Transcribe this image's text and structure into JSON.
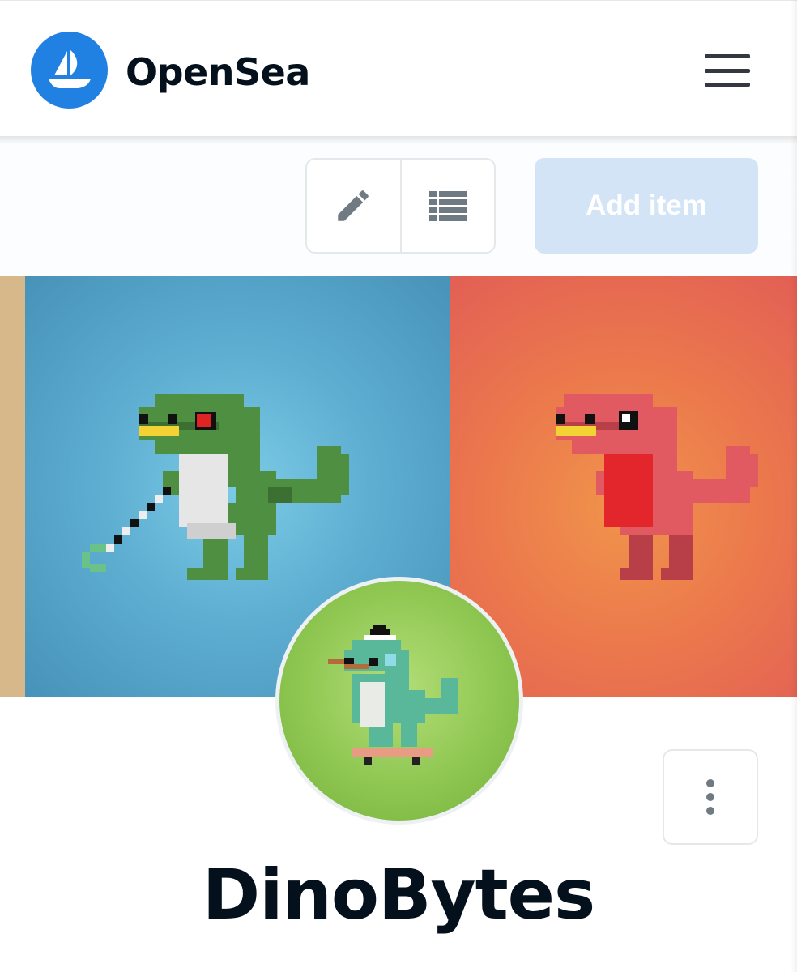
{
  "header": {
    "brand_name": "OpenSea",
    "logo_icon": "opensea-ship-icon",
    "menu_icon": "hamburger-menu-icon",
    "brand_color": "#2081e2"
  },
  "toolbar": {
    "edit_icon": "pencil-icon",
    "list_icon": "list-view-icon",
    "add_item_label": "Add item",
    "add_item_color": "#d3e4f7"
  },
  "banner": {
    "panels": [
      "tan",
      "blue",
      "red"
    ],
    "colors": {
      "tan": "#d6b88a",
      "blue": "#5eaed2",
      "red": "#ec7a4c"
    }
  },
  "profile": {
    "name": "DinoBytes",
    "avatar_background": "#8fc752",
    "more_icon": "more-vertical-icon"
  }
}
